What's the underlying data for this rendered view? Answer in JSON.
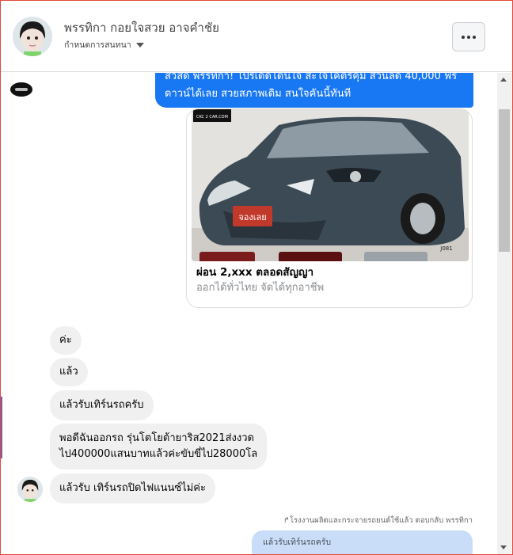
{
  "header": {
    "name": "พรรทิกา กอยใจสวย อาจคำชัย",
    "subtitle": "กำหนดการสนทนา",
    "more_icon": "more-horizontal-icon"
  },
  "messages": {
    "outgoing_text": "สวัสดี พรรทิกา! โปรเด็ดโดนใจ สะใจโคตรคุ้ม ส่วนลด 40,000 ฟรีดาวน์ได้เลย สวยสภาพเดิม สนใจคันนี้ทันที",
    "card": {
      "photo_tag": "จองเลย",
      "photo_logo": "CKC 2 CAR.COM",
      "photo_code": "J081",
      "title": "ผ่อน 2,xxx ตลอดสัญญา",
      "subtitle": "ออกได้ทั่วไทย จัดได้ทุกอาชีพ"
    },
    "incoming": [
      "ค่ะ",
      "แล้ว",
      "แล้วรับเทิร์นรถครับ",
      "พอดีฉันออกรถ รุ่นโตโยต้ายาริส2021ส่งงวด",
      "ไป400000แสนบาทแล้วค่ะขับขี่ไป28000โล",
      "แล้วรับ เทิร์นรถปิดไฟแนนซ์ไม่ค่ะ"
    ],
    "reply_meta": "โรงงานผลิตและกระจายรถยนต์ใช้แล้ว ตอบกลับ พรรทิกา",
    "reply_quote": "แล้วรับเทิร์นรถครับ"
  },
  "colors": {
    "brand_blue": "#1877f2",
    "incoming_bg": "#f0f0f0",
    "reply_bg": "#c9ddf8",
    "car_body": "#3b4a55"
  }
}
